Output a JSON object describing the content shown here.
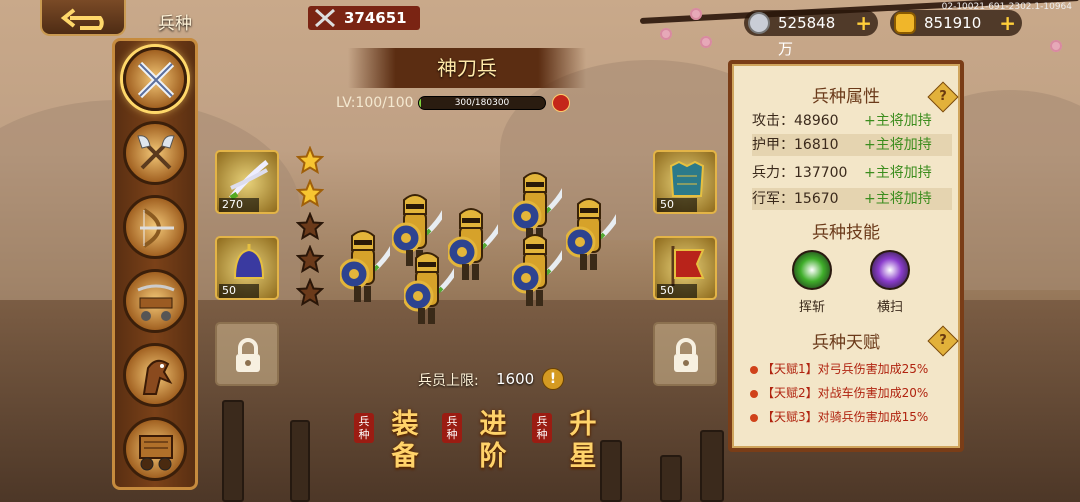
{
  "header": {
    "back_icon": "back-arrow-icon",
    "title": "兵种",
    "power": "374651",
    "silver": "525848万",
    "gold": "851910",
    "version": "02-10021-691-2302.1-10964"
  },
  "sidebar": {
    "items": [
      {
        "icon": "crossed-swords-icon",
        "active": true
      },
      {
        "icon": "crossed-axes-icon",
        "active": false
      },
      {
        "icon": "archer-bow-icon",
        "active": false
      },
      {
        "icon": "siege-crossbow-icon",
        "active": false
      },
      {
        "icon": "cavalry-horse-icon",
        "active": false
      },
      {
        "icon": "war-chariot-icon",
        "active": false
      }
    ]
  },
  "unit": {
    "name": "神刀兵",
    "level": "LV:100/100",
    "exp_text": "300/180300",
    "exp_fraction": 0.0017,
    "stars_filled": 2,
    "stars_total": 5,
    "capacity_label": "兵员上限:",
    "capacity_value": "1600"
  },
  "equipment": {
    "left": [
      {
        "icon": "twin-blades-icon",
        "count": "270"
      },
      {
        "icon": "helmet-icon",
        "count": "50"
      }
    ],
    "right": [
      {
        "icon": "armor-icon",
        "count": "50"
      },
      {
        "icon": "war-banner-icon",
        "count": "50"
      }
    ]
  },
  "actions": [
    {
      "tag": "兵种",
      "label": "装备"
    },
    {
      "tag": "兵种",
      "label": "进阶"
    },
    {
      "tag": "兵种",
      "label": "升星"
    }
  ],
  "panel": {
    "attr_title": "兵种属性",
    "stats": [
      {
        "label": "攻击：48960",
        "bonus": "+主将加持"
      },
      {
        "label": "护甲：16810",
        "bonus": "+主将加持"
      },
      {
        "label": "兵力：137700",
        "bonus": "+主将加持"
      },
      {
        "label": "行军：15670",
        "bonus": "+主将加持"
      }
    ],
    "skill_title": "兵种技能",
    "skills": [
      {
        "name": "挥斩",
        "color": "#3fae2a"
      },
      {
        "name": "横扫",
        "color": "#8a3ccc"
      }
    ],
    "talent_title": "兵种天赋",
    "talents": [
      {
        "tag": "【天赋1】",
        "text": "对弓兵伤害加成25%"
      },
      {
        "tag": "【天赋2】",
        "text": "对战车伤害加成20%"
      },
      {
        "tag": "【天赋3】",
        "text": "对骑兵伤害加成15%"
      }
    ]
  }
}
